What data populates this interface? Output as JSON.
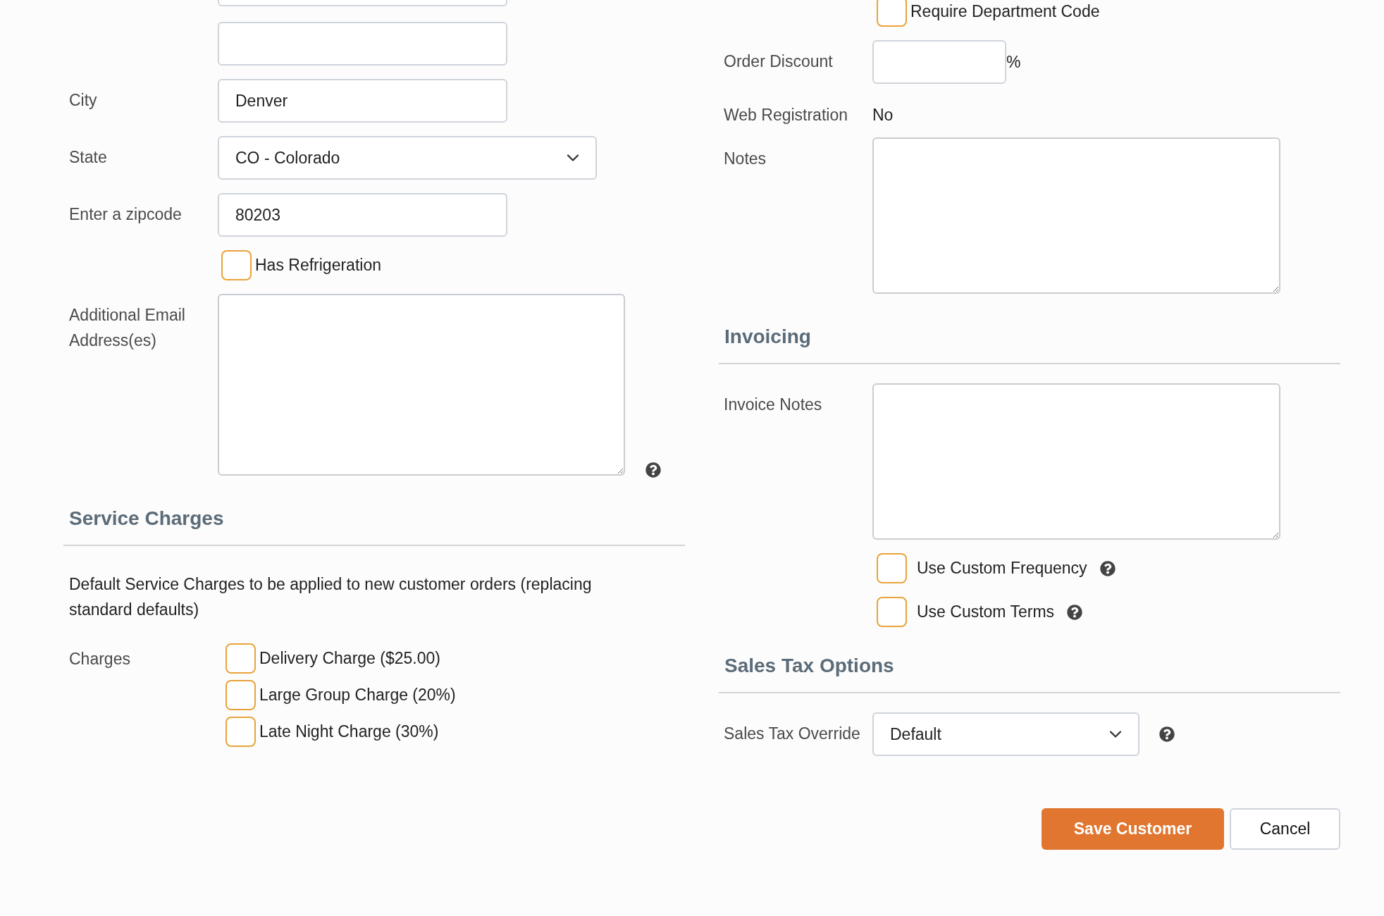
{
  "left_rows": [
    {
      "kind": "partial_input"
    },
    {
      "kind": "input"
    },
    {
      "kind": "input",
      "label": "City",
      "value": "Denver"
    },
    {
      "kind": "select",
      "label": "State",
      "value": "CO - Colorado"
    },
    {
      "kind": "input",
      "label": "Enter a zipcode",
      "value": "80203"
    },
    {
      "kind": "checkbox",
      "text": "Has Refrigeration",
      "checked": false
    },
    {
      "kind": "textarea",
      "label": "Additional Email Address(es)",
      "help": true
    }
  ],
  "service_charges": {
    "heading": "Service Charges",
    "description": "Default Service Charges to be applied to new customer orders (replacing standard defaults)",
    "label": "Charges",
    "options": [
      {
        "text": "Delivery Charge ($25.00)",
        "checked": false
      },
      {
        "text": "Large Group Charge (20%)",
        "checked": false
      },
      {
        "text": "Late Night Charge (30%)",
        "checked": false
      }
    ]
  },
  "right_rows": [
    {
      "kind": "checkbox",
      "text": "Require Department Code",
      "checked": false
    },
    {
      "kind": "input",
      "label": "Order Discount",
      "suffix": "%"
    },
    {
      "kind": "static",
      "label": "Web Registration",
      "value": "No"
    },
    {
      "kind": "textarea",
      "label": "Notes"
    }
  ],
  "invoicing": {
    "heading": "Invoicing",
    "rows": [
      {
        "kind": "textarea",
        "label": "Invoice Notes"
      },
      {
        "kind": "checkbox",
        "text": "Use Custom Frequency",
        "checked": false,
        "help": true
      },
      {
        "kind": "checkbox",
        "text": "Use Custom Terms",
        "checked": false,
        "help": true
      }
    ]
  },
  "sales_tax": {
    "heading": "Sales Tax Options",
    "rows": [
      {
        "kind": "select",
        "label": "Sales Tax Override",
        "value": "Default",
        "help": true
      }
    ]
  },
  "buttons": [
    {
      "label": "Save Customer",
      "kind": "primary"
    },
    {
      "label": "Cancel",
      "kind": "secondary"
    }
  ]
}
